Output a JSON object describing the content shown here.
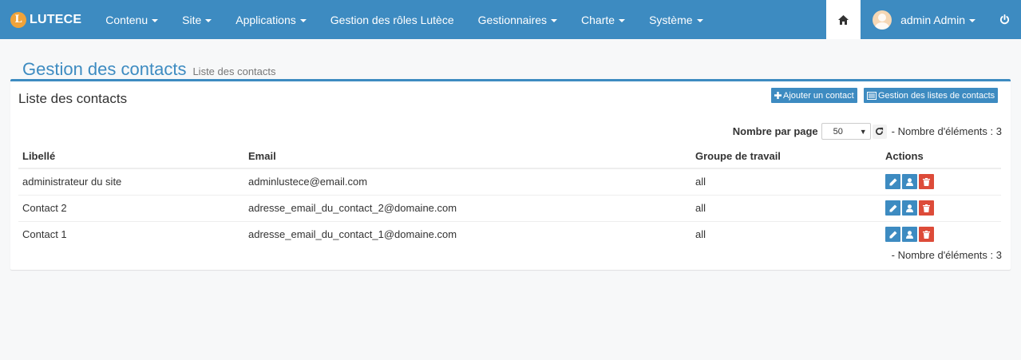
{
  "navbar": {
    "brand_letter": "L",
    "brand": "LUTECE",
    "menu": [
      {
        "label": "Contenu",
        "dropdown": true
      },
      {
        "label": "Site",
        "dropdown": true
      },
      {
        "label": "Applications",
        "dropdown": true
      },
      {
        "label": "Gestion des rôles Lutèce",
        "dropdown": false
      },
      {
        "label": "Gestionnaires",
        "dropdown": true
      },
      {
        "label": "Charte",
        "dropdown": true
      },
      {
        "label": "Système",
        "dropdown": true
      }
    ],
    "user": "admin Admin",
    "home_icon": "home-icon",
    "power_icon": "power-icon",
    "accent_color": "#3d8bc1"
  },
  "page": {
    "title": "Gestion des contacts",
    "subtitle": "Liste des contacts"
  },
  "box": {
    "title": "Liste des contacts",
    "add_button": "Ajouter un contact",
    "lists_button": "Gestion des listes de contacts"
  },
  "pager": {
    "label": "Nombre par page",
    "selected": "50",
    "count_text": "- Nombre d'éléments : 3"
  },
  "table": {
    "headers": [
      "Libellé",
      "Email",
      "Groupe de travail",
      "Actions"
    ],
    "rows": [
      {
        "label": "administrateur du site",
        "email": "adminlustece@email.com",
        "group": "all"
      },
      {
        "label": "Contact 2",
        "email": "adresse_email_du_contact_2@domaine.com",
        "group": "all"
      },
      {
        "label": "Contact 1",
        "email": "adresse_email_du_contact_1@domaine.com",
        "group": "all"
      }
    ]
  },
  "footer_count": "- Nombre d'éléments : 3"
}
